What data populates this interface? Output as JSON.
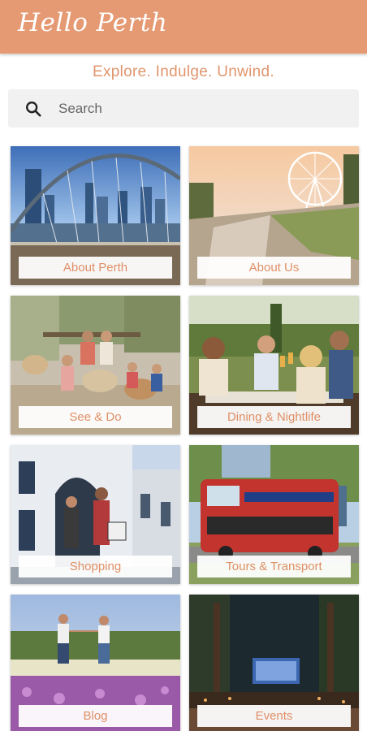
{
  "app": {
    "logo_text": "Hello Perth",
    "tagline": "Explore. Indulge. Unwind.",
    "brand_color": "#e59a73",
    "accent_text_color": "#e0956e"
  },
  "search": {
    "placeholder": "Search",
    "icon": "search-icon"
  },
  "tiles": [
    {
      "label": "About Perth"
    },
    {
      "label": "About Us"
    },
    {
      "label": "See & Do"
    },
    {
      "label": "Dining & Nightlife"
    },
    {
      "label": "Shopping"
    },
    {
      "label": "Tours & Transport"
    },
    {
      "label": "Blog"
    },
    {
      "label": "Events"
    }
  ]
}
